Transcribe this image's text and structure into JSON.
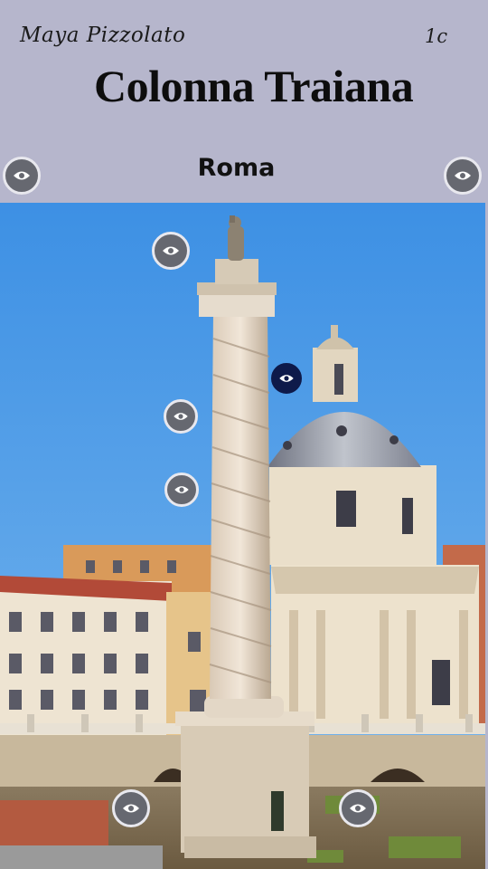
{
  "header": {
    "author": "Maya Pizzolato",
    "class_label": "1c",
    "title": "Colonna Traiana",
    "subtitle": "Roma"
  },
  "photo": {
    "subject": "Colonna Traiana"
  },
  "hotspots": [
    {
      "id": "hotspot-1",
      "icon": "eye-icon"
    },
    {
      "id": "hotspot-2",
      "icon": "eye-icon"
    },
    {
      "id": "hotspot-3",
      "icon": "eye-icon"
    },
    {
      "id": "hotspot-4",
      "icon": "eye-icon",
      "state": "active"
    },
    {
      "id": "hotspot-5",
      "icon": "eye-icon"
    },
    {
      "id": "hotspot-6",
      "icon": "eye-icon"
    },
    {
      "id": "hotspot-7",
      "icon": "eye-icon"
    },
    {
      "id": "hotspot-8",
      "icon": "eye-icon"
    }
  ],
  "colors": {
    "header_bg": "#b6b6cc",
    "hotspot_bg": "#666870",
    "hotspot_active_bg": "#0e1a4a",
    "sky": "#4a9be8"
  }
}
